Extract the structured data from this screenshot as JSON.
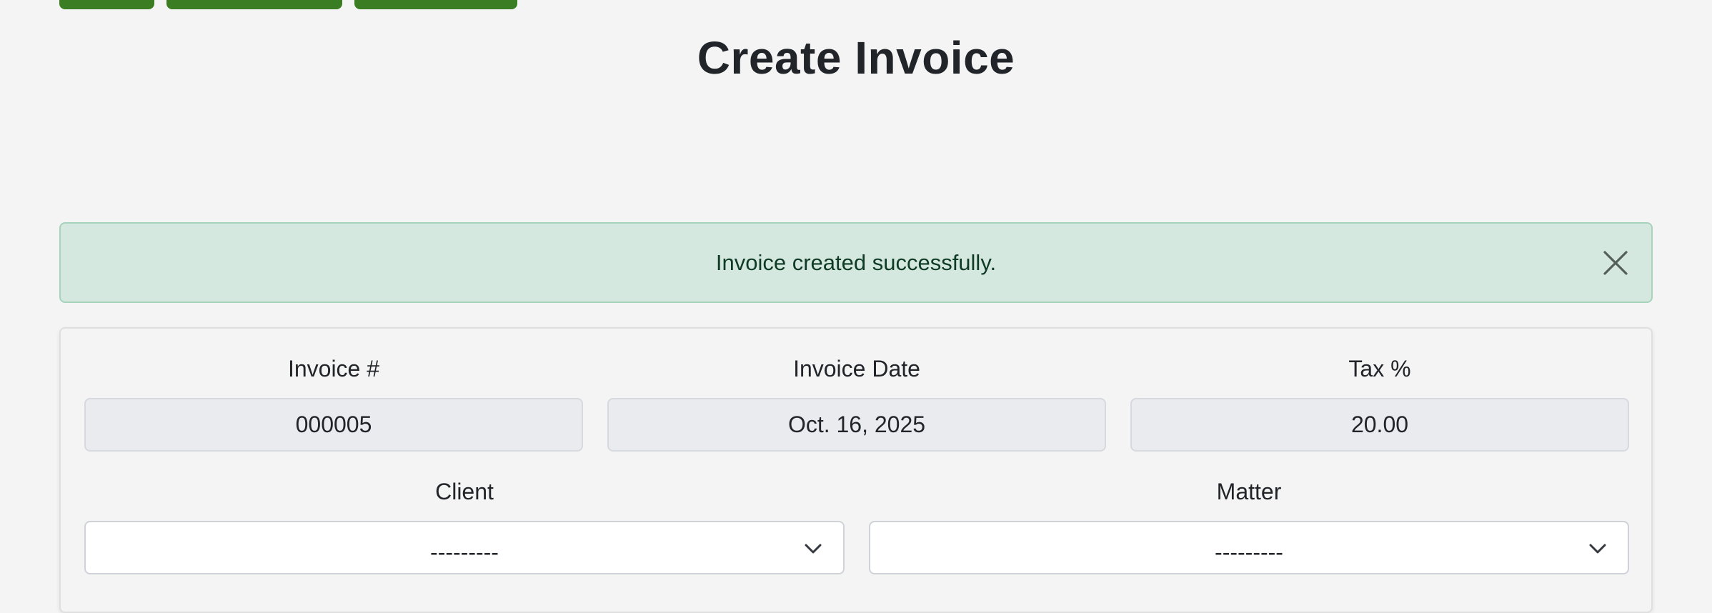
{
  "page": {
    "title": "Create Invoice"
  },
  "top_buttons": [
    {
      "label": ""
    },
    {
      "label": ""
    },
    {
      "label": ""
    }
  ],
  "alert": {
    "message": "Invoice created successfully.",
    "close_icon": "close-icon"
  },
  "form": {
    "invoice_number": {
      "label": "Invoice #",
      "value": "000005"
    },
    "invoice_date": {
      "label": "Invoice Date",
      "value": "Oct. 16, 2025"
    },
    "tax_percent": {
      "label": "Tax %",
      "value": "20.00"
    },
    "client": {
      "label": "Client",
      "selected": "---------"
    },
    "matter": {
      "label": "Matter",
      "selected": "---------"
    }
  },
  "colors": {
    "background": "#f4f4f4",
    "button_green": "#3a7d22",
    "alert_bg": "#d5e8df",
    "alert_border": "#a7d3bd",
    "readonly_field_bg": "#e9ebef"
  }
}
